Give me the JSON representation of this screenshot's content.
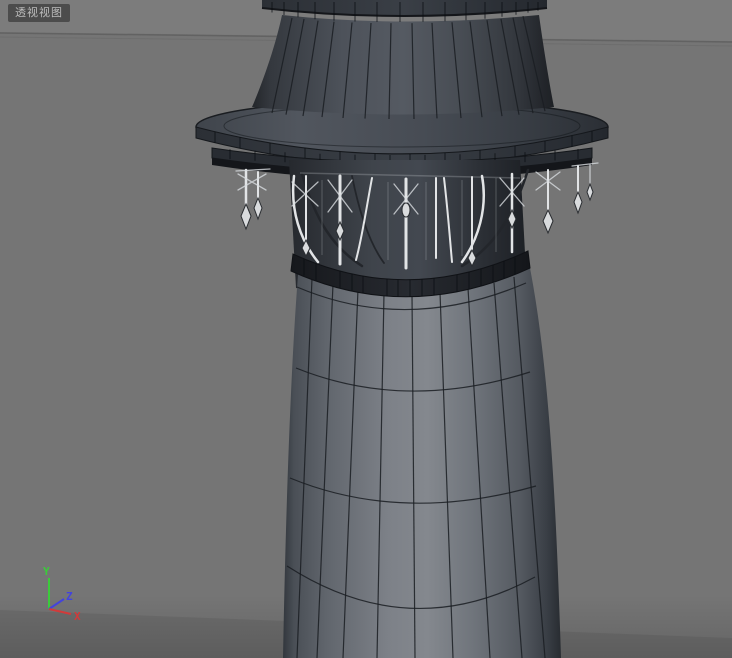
{
  "viewport": {
    "label": "透视视图",
    "background_color": "#757575",
    "horizon_band_color": "#7d7d7d",
    "ground_shadow_color": "rgba(0,0,0,0.13)"
  },
  "axis_gizmo": {
    "y": {
      "label": "Y",
      "color": "#3bcb3b"
    },
    "z": {
      "label": "Z",
      "color": "#4343dd"
    },
    "x": {
      "label": "X",
      "color": "#d23a3a"
    }
  },
  "model": {
    "description": "tapered lighthouse tower with gallery deck, ornate white support brackets and wireframe overlay",
    "colors": {
      "surface_highlight": "#84888e",
      "surface_mid": "#4d525a",
      "surface_dark": "#23262b",
      "wireframe": "#1a1d22",
      "ornament_white": "#e2e4e6"
    }
  }
}
